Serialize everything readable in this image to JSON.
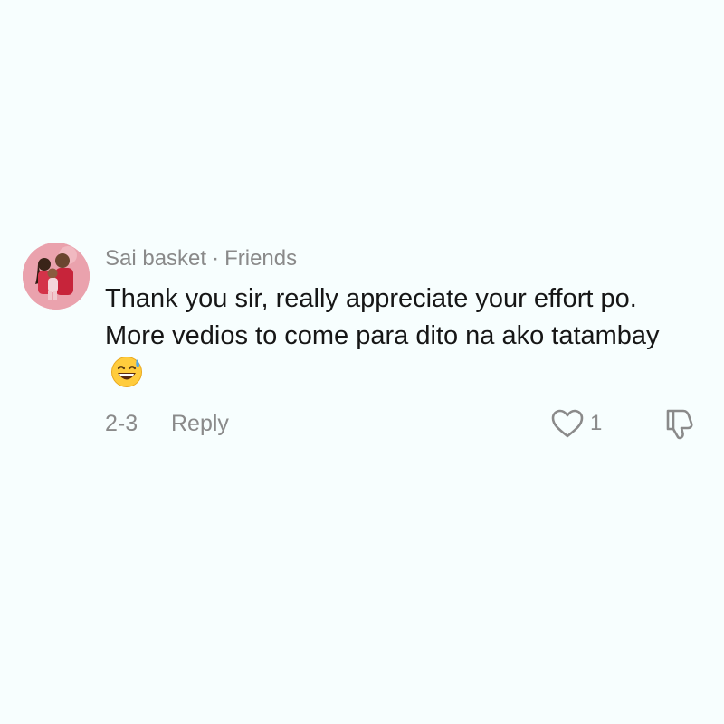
{
  "comment": {
    "username": "Sai basket",
    "separator": "·",
    "relation": "Friends",
    "text": "Thank you sir, really appreciate your effort po. More vedios to come para dito na ako tatambay",
    "emoji": "grinning-face-with-sweat",
    "date": "2-3",
    "reply_label": "Reply",
    "like_count": "1",
    "like_icon": "heart-outline-icon",
    "dislike_icon": "thumbs-down-outline-icon"
  },
  "colors": {
    "background": "#f7fefe",
    "text": "#161616",
    "muted": "#8a8a8a",
    "avatar_bg": "#e89aa6"
  }
}
